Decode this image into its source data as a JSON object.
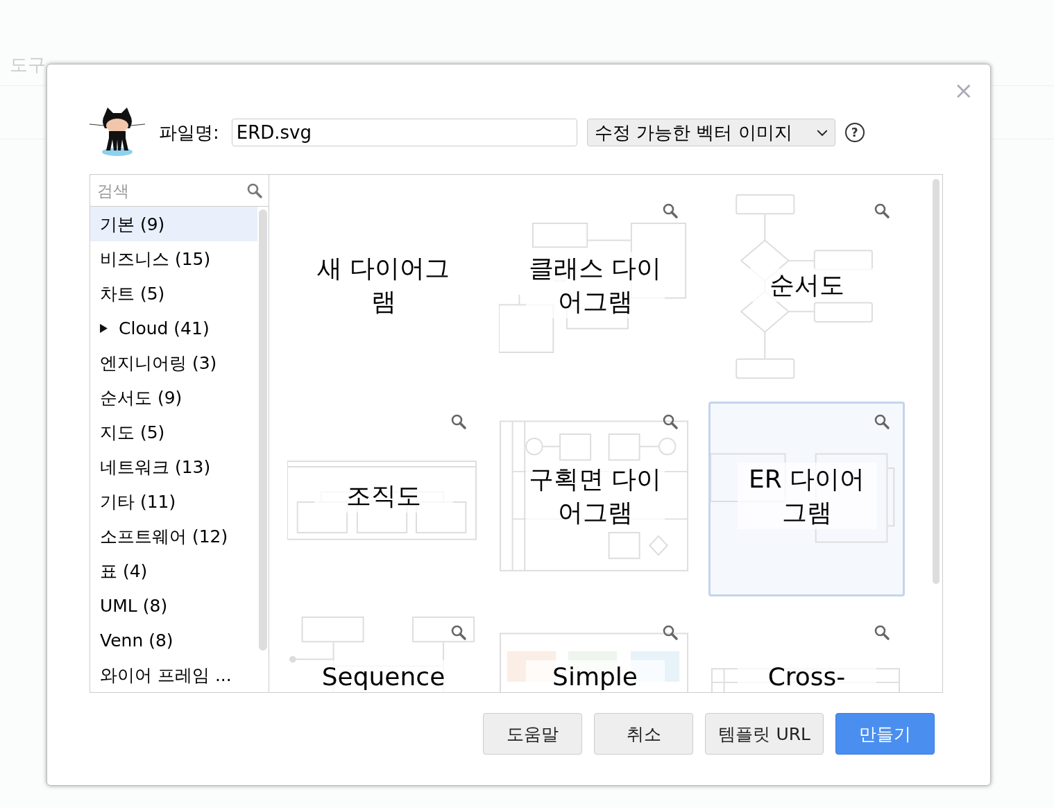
{
  "background_menu": [
    "도구"
  ],
  "dialog": {
    "close": "×",
    "filename_label": "파일명:",
    "filename": "ERD.svg",
    "format": "수정 가능한 벡터 이미지",
    "help": "?",
    "search": {
      "placeholder": "검색"
    },
    "categories": [
      {
        "label": "기본 (9)",
        "selected": true
      },
      {
        "label": "비즈니스 (15)",
        "selected": false
      },
      {
        "label": "차트 (5)",
        "selected": false
      },
      {
        "label": "Cloud (41)",
        "selected": false,
        "expandable": true
      },
      {
        "label": "엔지니어링 (3)",
        "selected": false
      },
      {
        "label": "순서도 (9)",
        "selected": false
      },
      {
        "label": "지도 (5)",
        "selected": false
      },
      {
        "label": "네트워크 (13)",
        "selected": false
      },
      {
        "label": "기타 (11)",
        "selected": false
      },
      {
        "label": "소프트웨어 (12)",
        "selected": false
      },
      {
        "label": "표 (4)",
        "selected": false
      },
      {
        "label": "UML (8)",
        "selected": false
      },
      {
        "label": "Venn (8)",
        "selected": false
      },
      {
        "label": "와이어 프레임 ...",
        "selected": false
      }
    ],
    "templates": [
      {
        "title": "새 다이어그램",
        "kind": "blank",
        "selected": false
      },
      {
        "title": "클래스 다이어그램",
        "kind": "class",
        "selected": false
      },
      {
        "title": "순서도",
        "kind": "flowchart",
        "selected": false
      },
      {
        "title": "조직도",
        "kind": "org",
        "selected": false
      },
      {
        "title": "구획면 다이어그램",
        "kind": "swimlane",
        "selected": false
      },
      {
        "title": "ER 다이어그램",
        "kind": "er",
        "selected": true
      },
      {
        "title": "Sequence",
        "kind": "sequence",
        "selected": false
      },
      {
        "title": "Simple",
        "kind": "simple",
        "selected": false
      },
      {
        "title": "Cross-",
        "kind": "cross",
        "selected": false
      }
    ],
    "buttons": [
      {
        "label": "도움말",
        "primary": false
      },
      {
        "label": "취소",
        "primary": false
      },
      {
        "label": "템플릿 URL",
        "primary": false
      },
      {
        "label": "만들기",
        "primary": true
      }
    ]
  }
}
